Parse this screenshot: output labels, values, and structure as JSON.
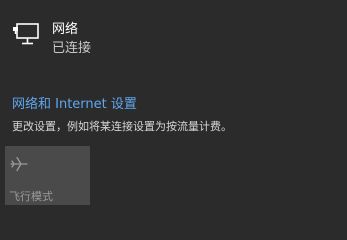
{
  "network": {
    "name": "网络",
    "status": "已连接",
    "icon": "ethernet-monitor-icon"
  },
  "settings": {
    "link_label": "网络和 Internet 设置",
    "description": "更改设置，例如将某连接设置为按流量计费。"
  },
  "quick_actions": {
    "airplane_mode": {
      "label": "飞行模式",
      "icon": "airplane-icon",
      "state": "off"
    }
  },
  "colors": {
    "background": "#2b2b2b",
    "tile": "#4a4a4a",
    "link": "#5fa8ee"
  }
}
